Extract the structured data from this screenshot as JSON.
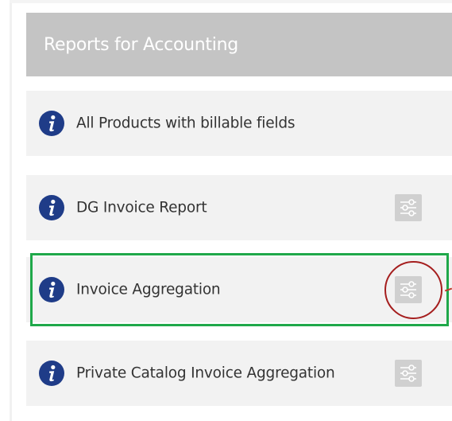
{
  "section": {
    "title": "Reports for Accounting"
  },
  "reports": [
    {
      "label": "All Products with billable fields",
      "has_settings": false
    },
    {
      "label": "DG Invoice Report",
      "has_settings": true
    },
    {
      "label": "Invoice Aggregation",
      "has_settings": true
    },
    {
      "label": "Private Catalog Invoice Aggregation",
      "has_settings": true
    }
  ],
  "icons": {
    "info": "info-icon",
    "settings": "sliders-settings-icon"
  },
  "colors": {
    "header_bg": "#c4c4c4",
    "row_bg": "#f2f2f2",
    "info_icon": "#1f3c88",
    "settings_icon": "#d0d0d0",
    "highlight_box": "#1fa84a",
    "circle_annotation": "#a51e1e"
  }
}
